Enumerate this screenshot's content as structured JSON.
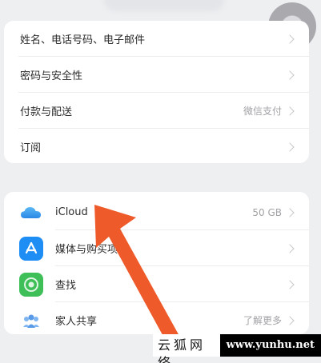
{
  "settings": {
    "account_group": [
      {
        "label": "姓名、电话号码、电子邮件",
        "detail": ""
      },
      {
        "label": "密码与安全性",
        "detail": ""
      },
      {
        "label": "付款与配送",
        "detail": "微信支付"
      },
      {
        "label": "订阅",
        "detail": ""
      }
    ],
    "services_group": [
      {
        "label": "iCloud",
        "detail": "50 GB",
        "icon": "icloud-icon"
      },
      {
        "label": "媒体与购买项目",
        "detail": "",
        "icon": "app-store-icon"
      },
      {
        "label": "查找",
        "detail": "",
        "icon": "find-my-icon"
      },
      {
        "label": "家人共享",
        "detail": "了解更多",
        "icon": "family-sharing-icon"
      }
    ]
  },
  "overlay": {
    "arrow_color": "#ee5a2a",
    "watermark_text": "云狐网络",
    "watermark_url": "www.yunhu.net"
  },
  "colors": {
    "background": "#eeeff1",
    "card": "#ffffff",
    "secondary_text": "#a2a2a7"
  }
}
